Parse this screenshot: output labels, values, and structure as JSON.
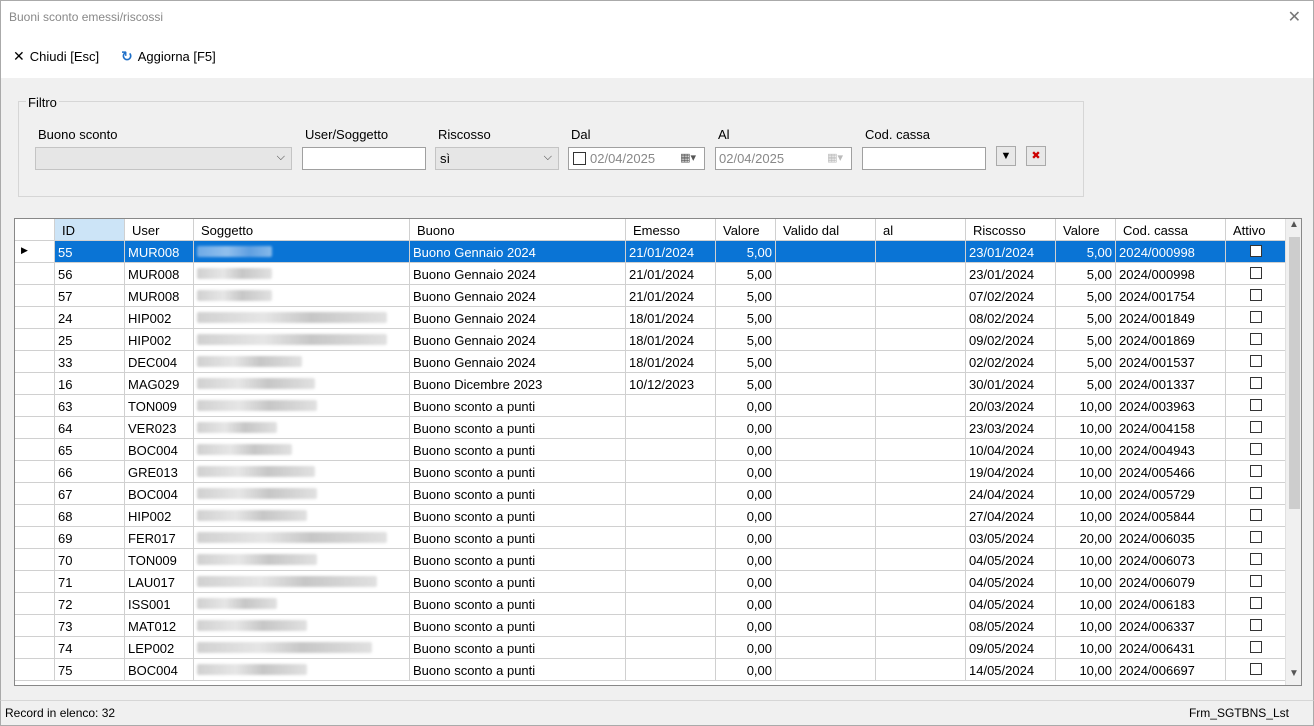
{
  "window": {
    "title": "Buoni sconto emessi/riscossi"
  },
  "toolbar": {
    "close_label": "Chiudi [Esc]",
    "refresh_label": "Aggiorna [F5]"
  },
  "filter": {
    "legend": "Filtro",
    "buono_label": "Buono sconto",
    "buono_value": "",
    "user_label": "User/Soggetto",
    "user_value": "",
    "riscosso_label": "Riscosso",
    "riscosso_value": "sì",
    "dal_label": "Dal",
    "dal_value": "02/04/2025",
    "al_label": "Al",
    "al_value": "02/04/2025",
    "cassa_label": "Cod. cassa",
    "cassa_value": ""
  },
  "grid": {
    "columns": [
      "ID",
      "User",
      "Soggetto",
      "Buono",
      "Emesso",
      "Valore",
      "Valido dal",
      "al",
      "Riscosso",
      "Valore",
      "Cod. cassa",
      "Attivo"
    ],
    "rows": [
      {
        "id": "55",
        "user": "MUR008",
        "buono": "Buono Gennaio 2024",
        "emesso": "21/01/2024",
        "valore": "5,00",
        "valido_dal": "",
        "al": "",
        "riscosso": "23/01/2024",
        "valore2": "5,00",
        "cassa": "2024/000998"
      },
      {
        "id": "56",
        "user": "MUR008",
        "buono": "Buono Gennaio 2024",
        "emesso": "21/01/2024",
        "valore": "5,00",
        "valido_dal": "",
        "al": "",
        "riscosso": "23/01/2024",
        "valore2": "5,00",
        "cassa": "2024/000998"
      },
      {
        "id": "57",
        "user": "MUR008",
        "buono": "Buono Gennaio 2024",
        "emesso": "21/01/2024",
        "valore": "5,00",
        "valido_dal": "",
        "al": "",
        "riscosso": "07/02/2024",
        "valore2": "5,00",
        "cassa": "2024/001754"
      },
      {
        "id": "24",
        "user": "HIP002",
        "buono": "Buono Gennaio 2024",
        "emesso": "18/01/2024",
        "valore": "5,00",
        "valido_dal": "",
        "al": "",
        "riscosso": "08/02/2024",
        "valore2": "5,00",
        "cassa": "2024/001849"
      },
      {
        "id": "25",
        "user": "HIP002",
        "buono": "Buono Gennaio 2024",
        "emesso": "18/01/2024",
        "valore": "5,00",
        "valido_dal": "",
        "al": "",
        "riscosso": "09/02/2024",
        "valore2": "5,00",
        "cassa": "2024/001869"
      },
      {
        "id": "33",
        "user": "DEC004",
        "buono": "Buono Gennaio 2024",
        "emesso": "18/01/2024",
        "valore": "5,00",
        "valido_dal": "",
        "al": "",
        "riscosso": "02/02/2024",
        "valore2": "5,00",
        "cassa": "2024/001537"
      },
      {
        "id": "16",
        "user": "MAG029",
        "buono": "Buono Dicembre 2023",
        "emesso": "10/12/2023",
        "valore": "5,00",
        "valido_dal": "",
        "al": "",
        "riscosso": "30/01/2024",
        "valore2": "5,00",
        "cassa": "2024/001337"
      },
      {
        "id": "63",
        "user": "TON009",
        "buono": "Buono sconto a punti",
        "emesso": "",
        "valore": "0,00",
        "valido_dal": "",
        "al": "",
        "riscosso": "20/03/2024",
        "valore2": "10,00",
        "cassa": "2024/003963"
      },
      {
        "id": "64",
        "user": "VER023",
        "buono": "Buono sconto a punti",
        "emesso": "",
        "valore": "0,00",
        "valido_dal": "",
        "al": "",
        "riscosso": "23/03/2024",
        "valore2": "10,00",
        "cassa": "2024/004158"
      },
      {
        "id": "65",
        "user": "BOC004",
        "buono": "Buono sconto a punti",
        "emesso": "",
        "valore": "0,00",
        "valido_dal": "",
        "al": "",
        "riscosso": "10/04/2024",
        "valore2": "10,00",
        "cassa": "2024/004943"
      },
      {
        "id": "66",
        "user": "GRE013",
        "buono": "Buono sconto a punti",
        "emesso": "",
        "valore": "0,00",
        "valido_dal": "",
        "al": "",
        "riscosso": "19/04/2024",
        "valore2": "10,00",
        "cassa": "2024/005466"
      },
      {
        "id": "67",
        "user": "BOC004",
        "buono": "Buono sconto a punti",
        "emesso": "",
        "valore": "0,00",
        "valido_dal": "",
        "al": "",
        "riscosso": "24/04/2024",
        "valore2": "10,00",
        "cassa": "2024/005729"
      },
      {
        "id": "68",
        "user": "HIP002",
        "buono": "Buono sconto a punti",
        "emesso": "",
        "valore": "0,00",
        "valido_dal": "",
        "al": "",
        "riscosso": "27/04/2024",
        "valore2": "10,00",
        "cassa": "2024/005844"
      },
      {
        "id": "69",
        "user": "FER017",
        "buono": "Buono sconto a punti",
        "emesso": "",
        "valore": "0,00",
        "valido_dal": "",
        "al": "",
        "riscosso": "03/05/2024",
        "valore2": "20,00",
        "cassa": "2024/006035"
      },
      {
        "id": "70",
        "user": "TON009",
        "buono": "Buono sconto a punti",
        "emesso": "",
        "valore": "0,00",
        "valido_dal": "",
        "al": "",
        "riscosso": "04/05/2024",
        "valore2": "10,00",
        "cassa": "2024/006073"
      },
      {
        "id": "71",
        "user": "LAU017",
        "buono": "Buono sconto a punti",
        "emesso": "",
        "valore": "0,00",
        "valido_dal": "",
        "al": "",
        "riscosso": "04/05/2024",
        "valore2": "10,00",
        "cassa": "2024/006079"
      },
      {
        "id": "72",
        "user": "ISS001",
        "buono": "Buono sconto a punti",
        "emesso": "",
        "valore": "0,00",
        "valido_dal": "",
        "al": "",
        "riscosso": "04/05/2024",
        "valore2": "10,00",
        "cassa": "2024/006183"
      },
      {
        "id": "73",
        "user": "MAT012",
        "buono": "Buono sconto a punti",
        "emesso": "",
        "valore": "0,00",
        "valido_dal": "",
        "al": "",
        "riscosso": "08/05/2024",
        "valore2": "10,00",
        "cassa": "2024/006337"
      },
      {
        "id": "74",
        "user": "LEP002",
        "buono": "Buono sconto a punti",
        "emesso": "",
        "valore": "0,00",
        "valido_dal": "",
        "al": "",
        "riscosso": "09/05/2024",
        "valore2": "10,00",
        "cassa": "2024/006431"
      },
      {
        "id": "75",
        "user": "BOC004",
        "buono": "Buono sconto a punti",
        "emesso": "",
        "valore": "0,00",
        "valido_dal": "",
        "al": "",
        "riscosso": "14/05/2024",
        "valore2": "10,00",
        "cassa": "2024/006697"
      }
    ]
  },
  "status": {
    "records": "Record in elenco: 32",
    "form_name": "Frm_SGTBNS_Lst"
  },
  "colors": {
    "selection": "#0a74d5",
    "header_selected": "#cce4f7",
    "refresh_icon": "#1e6fc8"
  },
  "icons": {
    "close": "close-icon",
    "refresh": "refresh-icon",
    "filter": "filter-icon",
    "clear_filter": "clear-filter-icon",
    "calendar": "calendar-icon"
  }
}
